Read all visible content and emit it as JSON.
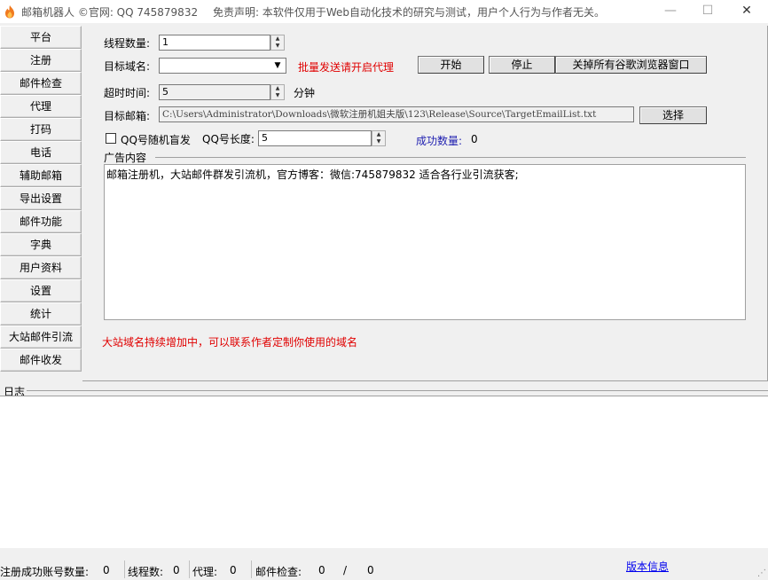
{
  "titlebar": {
    "title": "邮箱机器人 ©官网: QQ   745879832",
    "disclaimer": "免责声明: 本软件仅用于Web自动化技术的研究与测试，用户个人行为与作者无关。",
    "minimize": "—",
    "maximize": "☐",
    "close": "✕"
  },
  "sidebar": {
    "items": [
      {
        "label": "平台"
      },
      {
        "label": "注册"
      },
      {
        "label": "邮件检查"
      },
      {
        "label": "代理"
      },
      {
        "label": "打码"
      },
      {
        "label": "电话"
      },
      {
        "label": "辅助邮箱"
      },
      {
        "label": "导出设置"
      },
      {
        "label": "邮件功能"
      },
      {
        "label": "字典"
      },
      {
        "label": "用户资料"
      },
      {
        "label": "设置"
      },
      {
        "label": "统计"
      },
      {
        "label": "大站邮件引流"
      },
      {
        "label": "邮件收发"
      }
    ]
  },
  "form": {
    "thread_count_label": "线程数量:",
    "thread_count_value": "1",
    "target_domain_label": "目标域名:",
    "target_domain_value": "",
    "proxy_hint": "批量发送请开启代理",
    "start_label": "开始",
    "stop_label": "停止",
    "close_chrome_label": "关掉所有谷歌浏览器窗口",
    "timeout_label": "超时时间:",
    "timeout_value": "5",
    "timeout_unit": "分钟",
    "target_email_label": "目标邮箱:",
    "target_email_path": "C:\\Users\\Administrator\\Downloads\\微软注册机姐夫版\\123\\Release\\Source\\TargetEmailList.txt",
    "select_label": "选择",
    "qq_random_label": "QQ号随机盲发",
    "qq_length_label": "QQ号长度:",
    "qq_length_value": "5",
    "success_count_label": "成功数量:",
    "success_count_value": "0",
    "ad_content_label": "广告内容",
    "ad_content_value": "邮箱注册机，大站邮件群发引流机，官方博客：微信:745879832    适合各行业引流获客;",
    "domain_note": "大站域名持续增加中，可以联系作者定制你使用的域名"
  },
  "log": {
    "label": "日志"
  },
  "statusbar": {
    "reg_success_label": "注册成功账号数量:",
    "reg_success_value": "0",
    "threads_label": "线程数:",
    "threads_value": "0",
    "proxy_label": "代理:",
    "proxy_value": "0",
    "mail_check_label": "邮件检查:",
    "mail_check_value": "0",
    "mail_check_sep": "/",
    "mail_check_total": "0",
    "version_link": "版本信息"
  },
  "colors": {
    "hint_red": "#e00000",
    "success_blue": "#1f1fb0",
    "link_blue": "#0000ee"
  }
}
